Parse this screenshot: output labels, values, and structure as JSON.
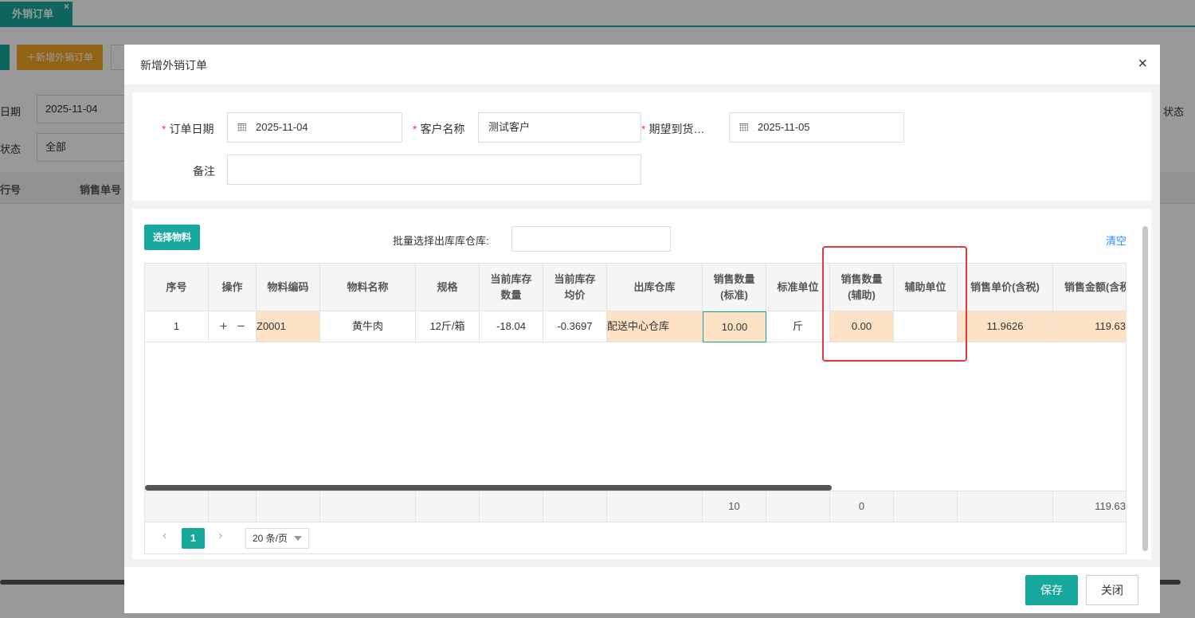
{
  "tab": {
    "label": "外销订单",
    "close": "×"
  },
  "background": {
    "add_button": "＋新增外销订单",
    "date_label": "日期",
    "date_value": "2025-11-04",
    "status_label": "状态",
    "status_value": "全部",
    "right_label": "状态",
    "col_line": "行号",
    "col_order": "销售单号"
  },
  "modal": {
    "title": "新增外销订单",
    "close_icon": "×",
    "form": {
      "order_date_label": "订单日期",
      "order_date_value": "2025-11-04",
      "customer_label": "客户名称",
      "customer_value": "测试客户",
      "expected_label": "期望到货…",
      "expected_value": "2025-11-05",
      "remark_label": "备注",
      "remark_value": "",
      "required_mark": "*"
    },
    "toolbar": {
      "select_material": "选择物料",
      "batch_warehouse_label": "批量选择出库库仓库:",
      "batch_warehouse_value": "",
      "clear": "清空"
    },
    "table": {
      "columns": [
        {
          "key": "seq",
          "label": "序号"
        },
        {
          "key": "op",
          "label": "操作"
        },
        {
          "key": "code",
          "label": "物料编码"
        },
        {
          "key": "name",
          "label": "物料名称"
        },
        {
          "key": "spec",
          "label": "规格"
        },
        {
          "key": "stock",
          "label": "当前库存\n数量"
        },
        {
          "key": "avg",
          "label": "当前库存\n均价"
        },
        {
          "key": "wh",
          "label": "出库仓库"
        },
        {
          "key": "qty_std",
          "label": "销售数量\n(标准)"
        },
        {
          "key": "unit_std",
          "label": "标准单位"
        },
        {
          "key": "qty_aux",
          "label": "销售数量\n(辅助)"
        },
        {
          "key": "unit_aux",
          "label": "辅助单位"
        },
        {
          "key": "price",
          "label": "销售单价(含税)"
        },
        {
          "key": "amount",
          "label": "销售金额(含税)"
        }
      ],
      "rows": [
        {
          "seq": "1",
          "op_add": "+",
          "op_remove": "−",
          "code": "Z0001",
          "name": "黄牛肉",
          "spec": "12斤/箱",
          "stock": "-18.04",
          "avg": "-0.3697",
          "wh": "配送中心仓库",
          "qty_std": "10.00",
          "unit_std": "斤",
          "qty_aux": "0.00",
          "unit_aux": "",
          "price": "11.9626",
          "amount": "119.63"
        }
      ],
      "footer": {
        "qty_std": "10",
        "qty_aux": "0",
        "amount": "119.63"
      }
    },
    "pager": {
      "prev": "‹",
      "current": "1",
      "next": "›",
      "page_size": "20 条/页"
    },
    "buttons": {
      "save": "保存",
      "close": "关闭"
    }
  },
  "colors": {
    "primary": "#17a89c",
    "accent_orange": "#f5a623",
    "highlight_red": "#e5393b",
    "cell_peach": "#fde2c6",
    "link_blue": "#1e90ff"
  }
}
